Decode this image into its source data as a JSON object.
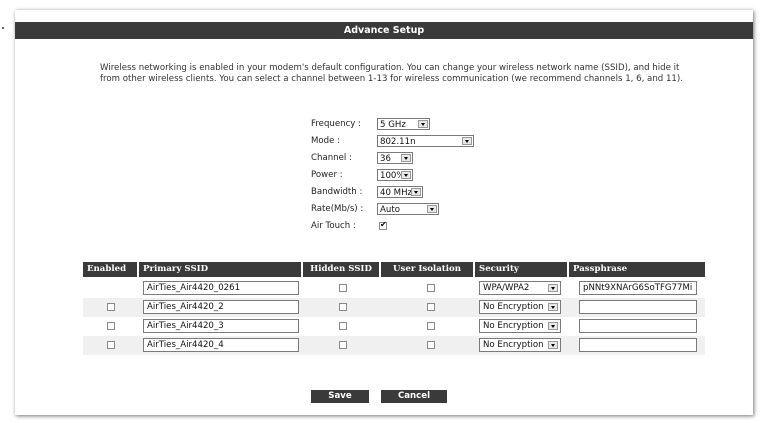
{
  "header": {
    "title": "Advance Setup"
  },
  "description": "Wireless networking is enabled in your modem's default configuration. You can change your wireless network name (SSID), and hide it from other wireless clients. You can select a channel between 1-13 for wireless communication (we recommend channels 1, 6, and 11).",
  "form": {
    "frequency": {
      "label": "Frequency :",
      "value": "5 GHz"
    },
    "mode": {
      "label": "Mode :",
      "value": "802.11n"
    },
    "channel": {
      "label": "Channel :",
      "value": "36"
    },
    "power": {
      "label": "Power :",
      "value": "100%"
    },
    "bandwidth": {
      "label": "Bandwidth :",
      "value": "40 MHz"
    },
    "rate": {
      "label": "Rate(Mb/s) :",
      "value": "Auto"
    },
    "air_touch": {
      "label": "Air Touch :",
      "checked": true
    }
  },
  "table": {
    "headers": [
      "Enabled",
      "Primary SSID",
      "Hidden SSID",
      "User Isolation",
      "Security",
      "Passphrase"
    ],
    "rows": [
      {
        "enabled": null,
        "ssid": "AirTies_Air4420_0261",
        "hidden": false,
        "isolation": false,
        "security": "WPA/WPA2",
        "passphrase": "pNNt9XNArG6SoTFG77Mi"
      },
      {
        "enabled": false,
        "ssid": "AirTies_Air4420_2",
        "hidden": false,
        "isolation": false,
        "security": "No Encryption",
        "passphrase": ""
      },
      {
        "enabled": false,
        "ssid": "AirTies_Air4420_3",
        "hidden": false,
        "isolation": false,
        "security": "No Encryption",
        "passphrase": ""
      },
      {
        "enabled": false,
        "ssid": "AirTies_Air4420_4",
        "hidden": false,
        "isolation": false,
        "security": "No Encryption",
        "passphrase": ""
      }
    ]
  },
  "buttons": {
    "save": "Save",
    "cancel": "Cancel"
  }
}
